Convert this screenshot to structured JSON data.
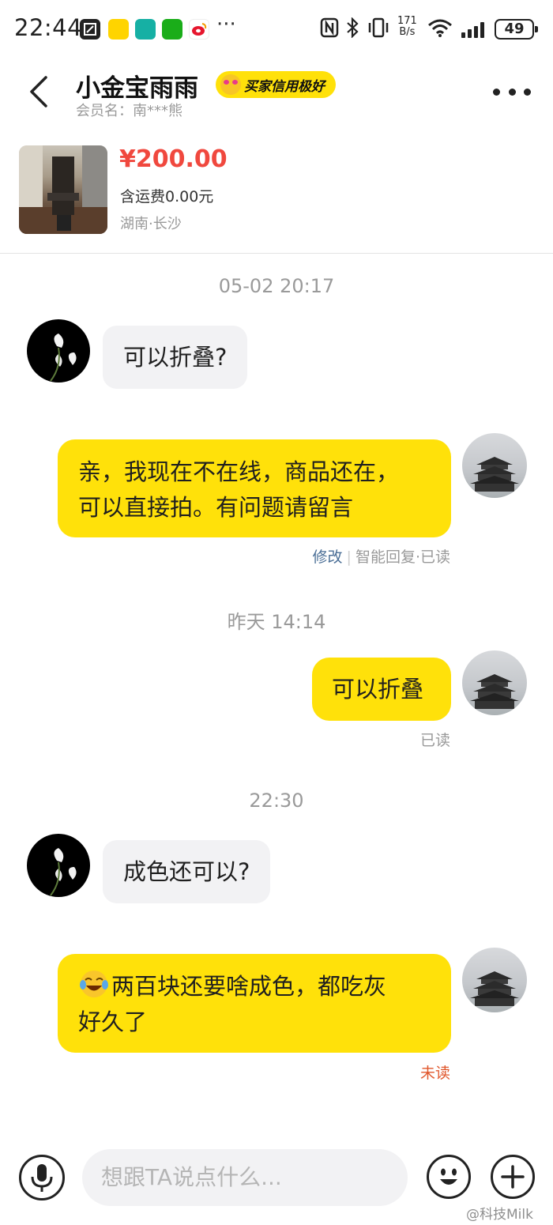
{
  "status_bar": {
    "time": "22:44",
    "speed_value": "171",
    "speed_unit": "B/s",
    "battery": "49",
    "more_icons": "···"
  },
  "header": {
    "nickname": "小金宝雨雨",
    "credit_badge": "买家信用极好",
    "member_label": "会员名：南***熊"
  },
  "product": {
    "price": "¥200.00",
    "shipping": "含运费0.00元",
    "location": "湖南·长沙"
  },
  "chat": {
    "ts1": "05-02 20:17",
    "msg1": "可以折叠?",
    "msg2_line1": "亲，我现在不在线，商品还在，",
    "msg2_line2": "可以直接拍。有问题请留言",
    "msg2_edit": "修改",
    "msg2_status": "智能回复·已读",
    "ts2": "昨天 14:14",
    "msg3": "可以折叠",
    "msg3_status": "已读",
    "ts3": "22:30",
    "msg4": "成色还可以?",
    "msg5_line1": "两百块还要啥成色，都吃灰",
    "msg5_line2": "好久了",
    "msg5_status": "未读"
  },
  "input": {
    "placeholder": "想跟TA说点什么..."
  },
  "watermark": "@科技Milk",
  "colors": {
    "accent_yellow": "#ffe10a",
    "price_red": "#f0483e",
    "unread_orange": "#e0572c",
    "edit_blue": "#4a6e96"
  }
}
